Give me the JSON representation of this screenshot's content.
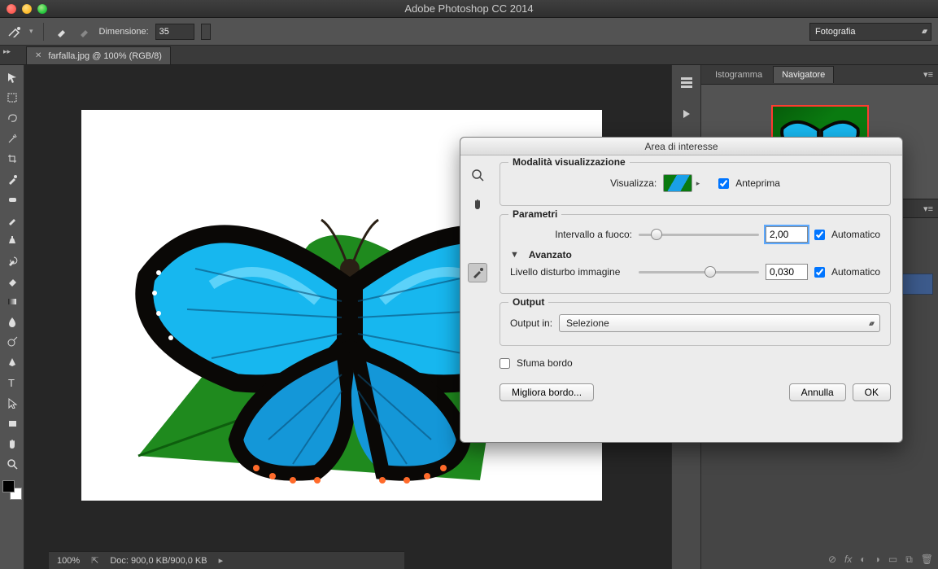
{
  "app": {
    "title": "Adobe Photoshop CC 2014"
  },
  "options_bar": {
    "size_label": "Dimensione:",
    "size_value": "35",
    "workspace": "Fotografia"
  },
  "document": {
    "tab_title": "farfalla.jpg @ 100% (RGB/8)"
  },
  "right_panels": {
    "tabs": {
      "histogram": "Istogramma",
      "navigator": "Navigatore"
    }
  },
  "status": {
    "zoom": "100%",
    "doc_info": "Doc: 900,0 KB/900,0 KB"
  },
  "dialog": {
    "title": "Area di interesse",
    "view_mode": {
      "legend": "Modalità visualizzazione",
      "visualize_label": "Visualizza:",
      "preview_label": "Anteprima",
      "preview_checked": true
    },
    "params": {
      "legend": "Parametri",
      "focus_range_label": "Intervallo a fuoco:",
      "focus_range_value": "2,00",
      "focus_auto_label": "Automatico",
      "focus_auto_checked": true,
      "advanced_label": "Avanzato",
      "noise_label": "Livello disturbo immagine",
      "noise_value": "0,030",
      "noise_auto_label": "Automatico",
      "noise_auto_checked": true
    },
    "output": {
      "legend": "Output",
      "output_in_label": "Output in:",
      "output_selection": "Selezione"
    },
    "soften_edge_label": "Sfuma bordo",
    "soften_edge_checked": false,
    "buttons": {
      "refine": "Migliora bordo...",
      "cancel": "Annulla",
      "ok": "OK"
    }
  }
}
